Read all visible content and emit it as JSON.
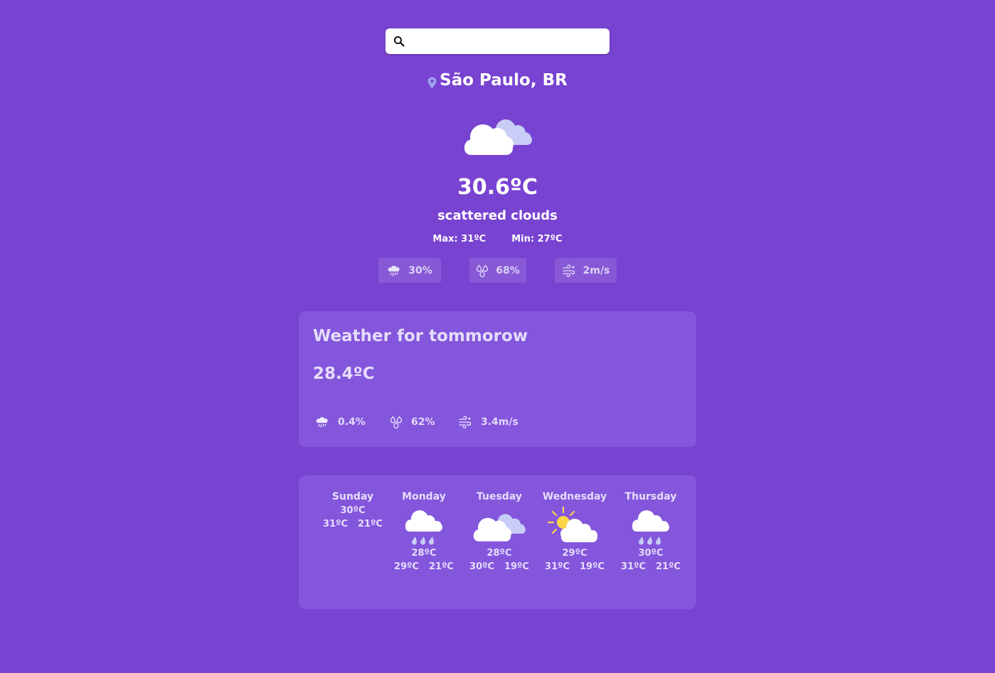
{
  "search": {
    "placeholder": "",
    "value": "",
    "icon": "search-icon"
  },
  "location": {
    "name": "São Paulo, BR",
    "icon": "location-pin-icon"
  },
  "current": {
    "temperature": "30.6ºC",
    "description": "scattered clouds",
    "icon": "scattered-clouds-icon",
    "max": "Max: 31ºC",
    "min": "Min: 27ºC",
    "stats": [
      {
        "icon": "rain-cloud-icon",
        "value": "30%"
      },
      {
        "icon": "humidity-icon",
        "value": "68%"
      },
      {
        "icon": "wind-icon",
        "value": "2m/s"
      }
    ]
  },
  "tomorrow": {
    "title": "Weather for tommorow",
    "temperature": "28.4ºC",
    "stats": [
      {
        "icon": "rain-cloud-icon",
        "value": "0.4%"
      },
      {
        "icon": "humidity-icon",
        "value": "62%"
      },
      {
        "icon": "wind-icon",
        "value": "3.4m/s"
      }
    ]
  },
  "forecast": [
    {
      "day": "Sunday",
      "temp": "30ºC",
      "max": "31ºC",
      "min": "21ºC",
      "icon": "none"
    },
    {
      "day": "Monday",
      "temp": "28ºC",
      "max": "29ºC",
      "min": "21ºC",
      "icon": "rain-icon"
    },
    {
      "day": "Tuesday",
      "temp": "28ºC",
      "max": "30ºC",
      "min": "19ºC",
      "icon": "scattered-clouds-icon"
    },
    {
      "day": "Wednesday",
      "temp": "29ºC",
      "max": "31ºC",
      "min": "19ºC",
      "icon": "partly-sunny-icon"
    },
    {
      "day": "Thursday",
      "temp": "30ºC",
      "max": "31ºC",
      "min": "21ºC",
      "icon": "rain-icon"
    }
  ],
  "colors": {
    "background": "#7843d1",
    "card": "#8456dc",
    "text": "#ffffff"
  }
}
